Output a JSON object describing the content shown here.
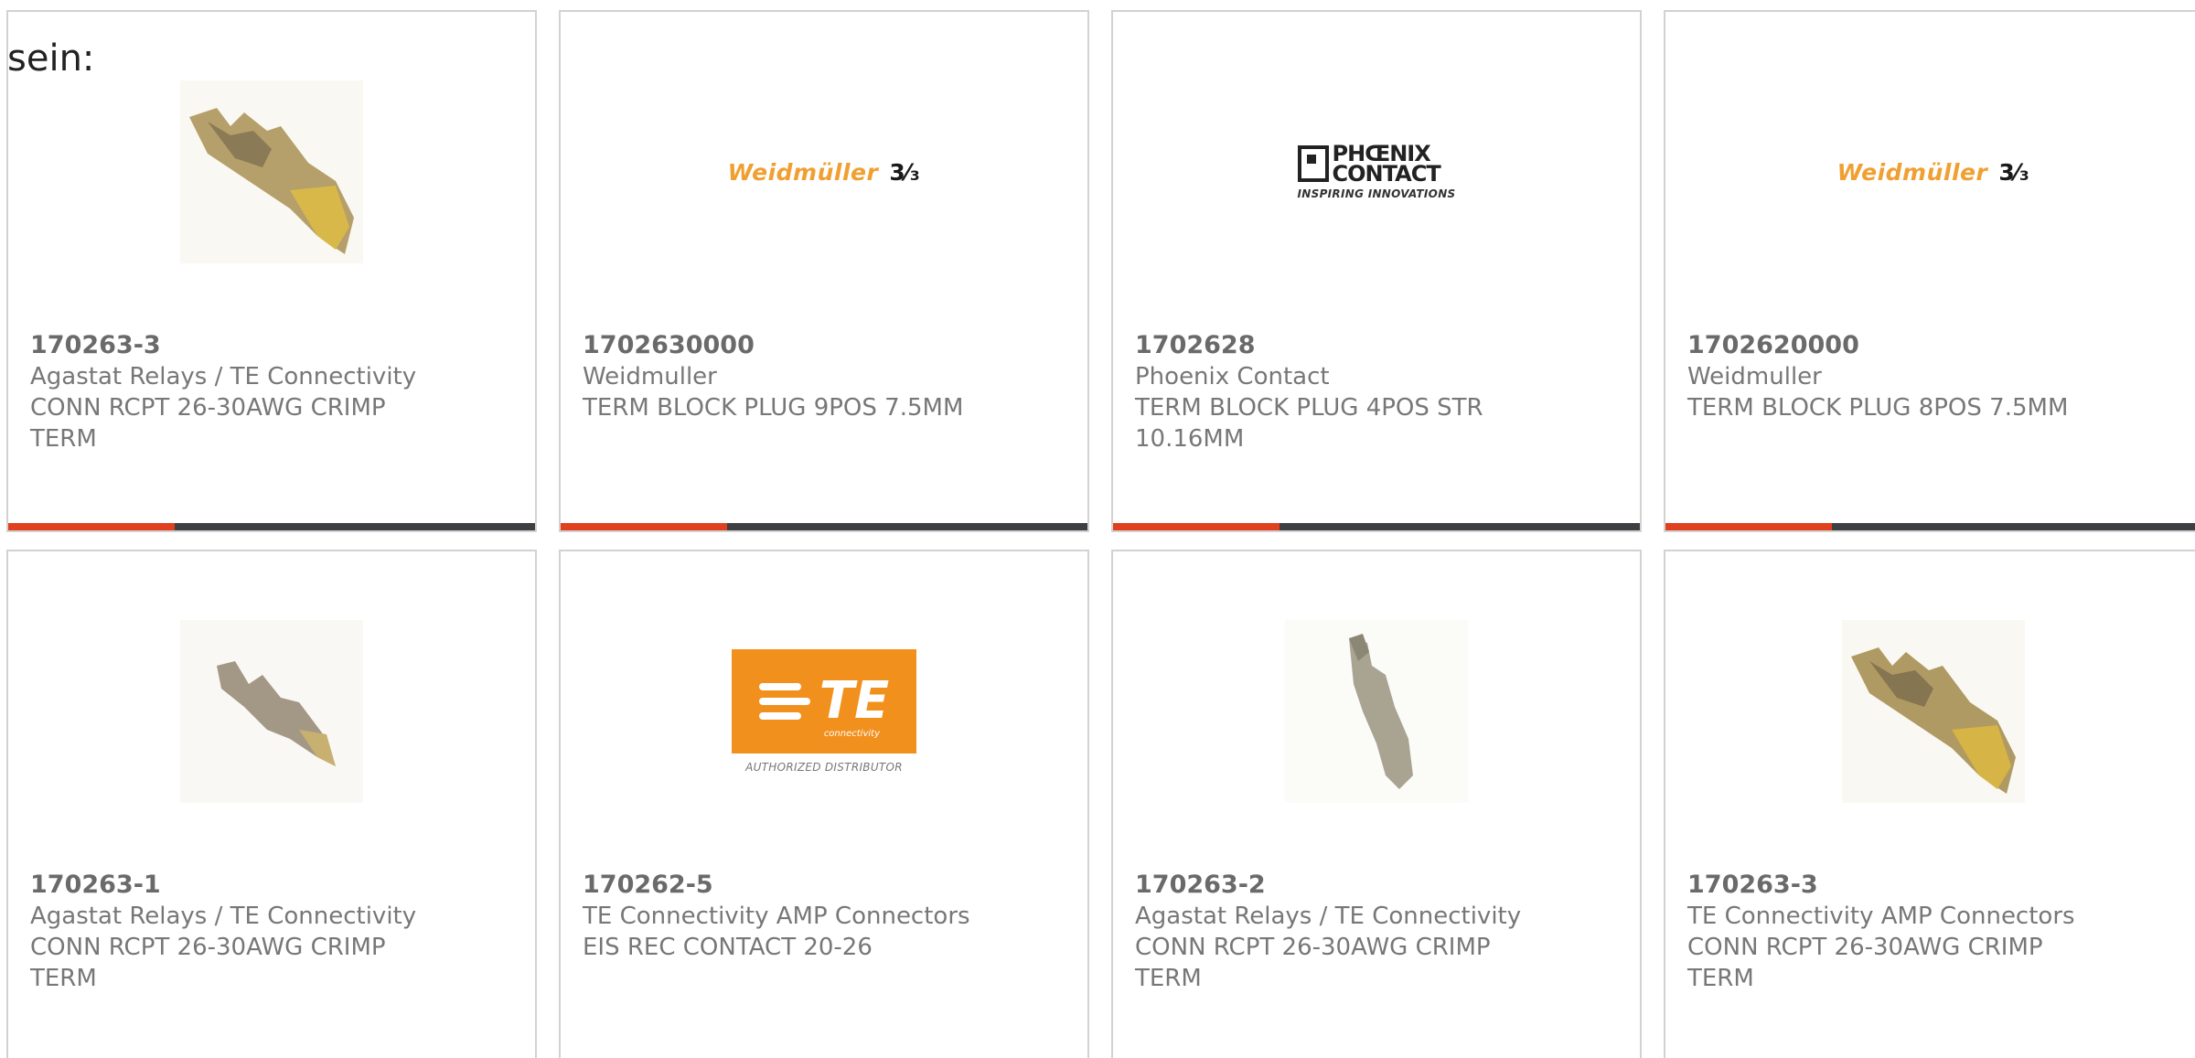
{
  "intro_text": "sein:",
  "colors": {
    "accent": "#e0401e",
    "bar": "#3d3f42",
    "border": "#d2d2d2"
  },
  "products": [
    {
      "part_number": "170263-3",
      "manufacturer": "Agastat Relays / TE Connectivity",
      "description": "CONN RCPT 26-30AWG CRIMP TERM",
      "image": "crimp-terminal-photo-gold"
    },
    {
      "part_number": "1702630000",
      "manufacturer": "Weidmuller",
      "description": "TERM BLOCK PLUG 9POS 7.5MM",
      "image": "weidmuller-logo",
      "logo_text": "Weidmüller",
      "logo_mark": "3⁄₃"
    },
    {
      "part_number": "1702628",
      "manufacturer": "Phoenix Contact",
      "description": "TERM BLOCK PLUG 4POS STR 10.16MM",
      "image": "phoenix-contact-logo",
      "logo_line1": "PHŒNIX",
      "logo_line2": "CONTACT",
      "logo_tag": "INSPIRING INNOVATIONS"
    },
    {
      "part_number": "1702620000",
      "manufacturer": "Weidmuller",
      "description": "TERM BLOCK PLUG 8POS 7.5MM",
      "image": "weidmuller-logo",
      "logo_text": "Weidmüller",
      "logo_mark": "3⁄₃"
    },
    {
      "part_number": "170263-1",
      "manufacturer": "Agastat Relays / TE Connectivity",
      "description": "CONN RCPT 26-30AWG CRIMP TERM",
      "image": "crimp-terminal-photo-silver"
    },
    {
      "part_number": "170262-5",
      "manufacturer": "TE Connectivity AMP Connectors",
      "description": "EIS REC CONTACT 20-26",
      "image": "te-connectivity-logo",
      "logo_text": "TE",
      "logo_sub": "connectivity",
      "logo_tag": "AUTHORIZED DISTRIBUTOR"
    },
    {
      "part_number": "170263-2",
      "manufacturer": "Agastat Relays / TE Connectivity",
      "description": "CONN RCPT 26-30AWG CRIMP TERM",
      "image": "crimp-terminal-photo-silver-vertical"
    },
    {
      "part_number": "170263-3",
      "manufacturer": "TE Connectivity AMP Connectors",
      "description": "CONN RCPT 26-30AWG CRIMP TERM",
      "image": "crimp-terminal-photo-gold"
    }
  ]
}
